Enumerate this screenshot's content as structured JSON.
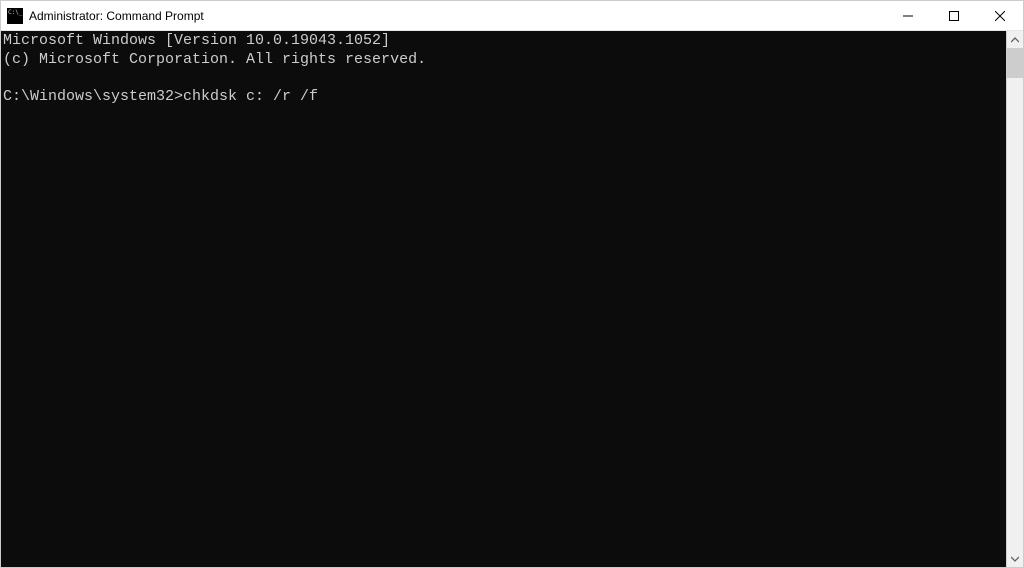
{
  "window": {
    "title": "Administrator: Command Prompt"
  },
  "terminal": {
    "line1": "Microsoft Windows [Version 10.0.19043.1052]",
    "line2": "(c) Microsoft Corporation. All rights reserved.",
    "blank": "",
    "prompt": "C:\\Windows\\system32>",
    "command": "chkdsk c: /r /f"
  }
}
